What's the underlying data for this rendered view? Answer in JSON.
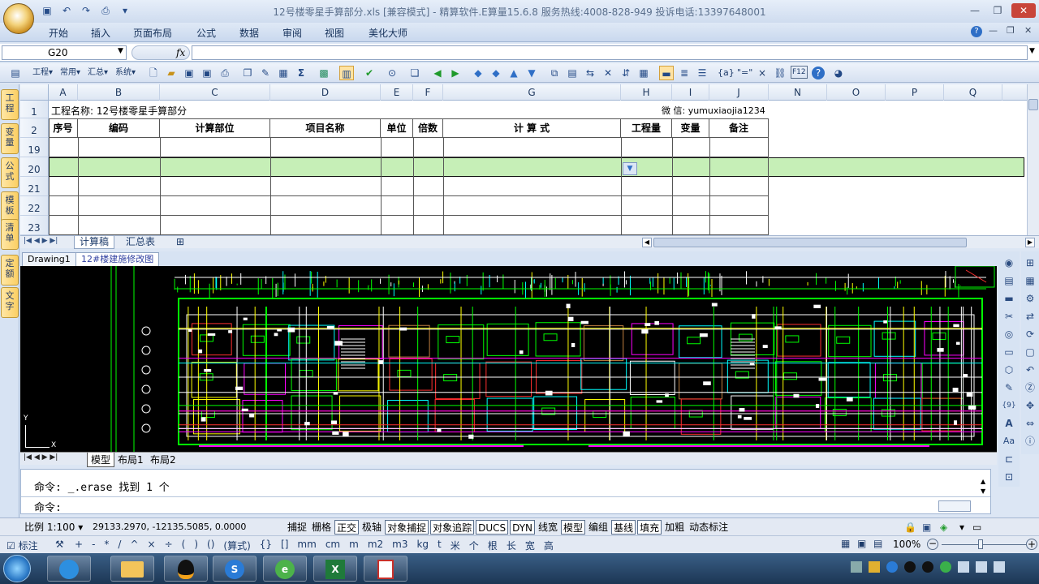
{
  "window": {
    "title": "12号楼零星手算部分.xls  [兼容模式]  - 精算软件.E算量15.6.8 服务热线:4008-828-949 投诉电话:13397648001",
    "min": "—",
    "restore": "❐",
    "close": "✕",
    "sub_min": "—",
    "sub_restore": "❐",
    "sub_close": "✕"
  },
  "menu": [
    "开始",
    "插入",
    "页面布局",
    "公式",
    "数据",
    "审阅",
    "视图",
    "美化大师"
  ],
  "formula": {
    "name_box": "G20",
    "fx": "fx",
    "value": ""
  },
  "toolbar": {
    "gongcheng": "工程",
    "changyong": "常用",
    "huizong": "汇总",
    "xitong": "系统",
    "sigma": "Σ",
    "braces": "{a}",
    "equals": "\"=\"",
    "times": "×",
    "f12": "F12"
  },
  "dock_tabs": [
    "工程",
    "变量",
    "公式",
    "模板",
    "清单",
    "定额",
    "文字"
  ],
  "sheet": {
    "columns": [
      "A",
      "B",
      "C",
      "D",
      "E",
      "F",
      "G",
      "H",
      "I",
      "J",
      "N",
      "O",
      "P",
      "Q"
    ],
    "rows": [
      "1",
      "2",
      "19",
      "20",
      "21",
      "22",
      "23"
    ],
    "project_name": "工程名称: 12号楼零星手算部分",
    "wechat": "微 信: yumuxiaojia1234",
    "headers": [
      "序号",
      "编码",
      "计算部位",
      "项目名称",
      "单位",
      "倍数",
      "计 算 式",
      "工程量",
      "变量",
      "备注"
    ],
    "tabs": [
      "计算稿",
      "汇总表"
    ]
  },
  "cad": {
    "doc_tabs": [
      "Drawing1",
      "12#楼建施修改图"
    ],
    "layout_tabs": [
      "模型",
      "布局1",
      "布局2"
    ],
    "axis_y": "Y",
    "axis_x": "X",
    "command_lines": [
      "命令: _.erase 找到 1 个",
      "命令:"
    ]
  },
  "status": {
    "scale": "比例 1:100",
    "coords": "29133.2970, -12135.5085, 0.0000",
    "toggles": [
      {
        "label": "捕捉",
        "on": false
      },
      {
        "label": "栅格",
        "on": false
      },
      {
        "label": "正交",
        "on": true
      },
      {
        "label": "极轴",
        "on": false
      },
      {
        "label": "对象捕捉",
        "on": true
      },
      {
        "label": "对象追踪",
        "on": true
      },
      {
        "label": "DUCS",
        "on": true
      },
      {
        "label": "DYN",
        "on": true
      },
      {
        "label": "线宽",
        "on": false
      },
      {
        "label": "模型",
        "on": true
      },
      {
        "label": "编组",
        "on": false
      },
      {
        "label": "基线",
        "on": true
      },
      {
        "label": "填充",
        "on": true
      },
      {
        "label": "加粗",
        "on": false
      },
      {
        "label": "动态标注",
        "on": false
      }
    ]
  },
  "unitbar": {
    "label": "标注",
    "items": [
      "+",
      "-",
      "*",
      "/",
      "^",
      "×",
      "÷",
      "(",
      ")",
      "()",
      "(算式)",
      "{}",
      "[]",
      "mm",
      "cm",
      "m",
      "m2",
      "m3",
      "kg",
      "t",
      "米",
      "个",
      "根",
      "长",
      "宽",
      "高"
    ],
    "zoom": "100%"
  },
  "colors": {
    "accent": "#c6efb7",
    "dock": "#fbcf63",
    "cad_bg": "#000000"
  }
}
